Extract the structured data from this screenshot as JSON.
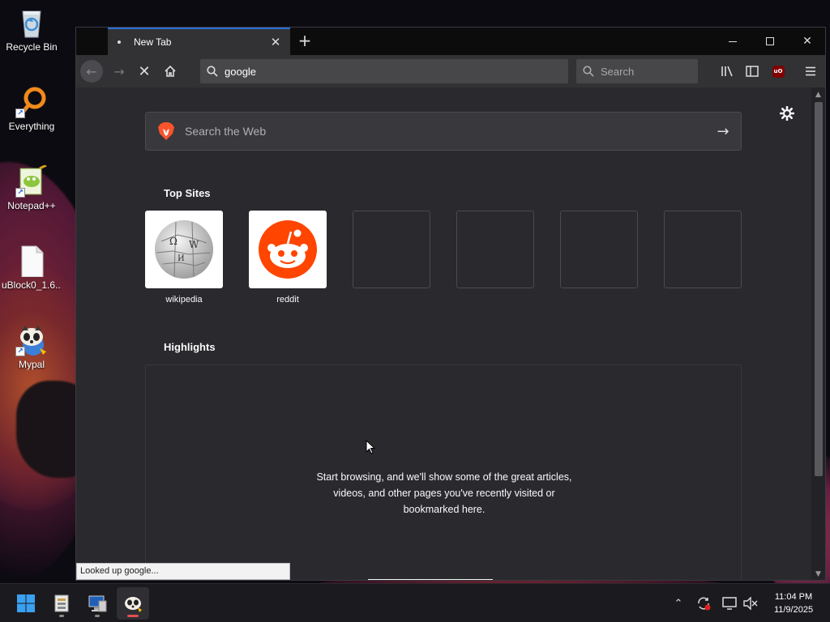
{
  "desktop": {
    "icons": [
      {
        "label": "Recycle Bin",
        "icon": "recycle-bin-icon"
      },
      {
        "label": "Everything",
        "icon": "everything-search-icon"
      },
      {
        "label": "Notepad++",
        "icon": "notepad-plus-plus-icon"
      },
      {
        "label": "uBlock0_1.6...",
        "icon": "file-icon"
      },
      {
        "label": "Mypal",
        "icon": "mypal-browser-icon"
      }
    ]
  },
  "browser": {
    "tab": {
      "title": "New Tab",
      "close_icon": "close-icon"
    },
    "new_tab_icon": "plus-icon",
    "window_controls": {
      "minimize": "minimize-icon",
      "maximize": "maximize-icon",
      "close": "close-icon"
    },
    "navbar": {
      "url_value": "google",
      "search_placeholder": "Search"
    },
    "page": {
      "search_web_placeholder": "Search the Web",
      "top_sites_title": "Top Sites",
      "top_sites": [
        {
          "label": "wikipedia",
          "icon": "wikipedia-globe-icon"
        },
        {
          "label": "reddit",
          "icon": "reddit-icon"
        },
        {
          "label": ""
        },
        {
          "label": ""
        },
        {
          "label": ""
        },
        {
          "label": ""
        }
      ],
      "highlights_title": "Highlights",
      "highlights_line1": "Start browsing, and we'll show some of the great articles,",
      "highlights_line2": "videos, and other pages you've recently visited or",
      "highlights_line3": "bookmarked here."
    },
    "status_text": "Looked up google..."
  },
  "taskbar": {
    "clock_time": "11:04 PM",
    "clock_date": "11/9/2025",
    "apps": [
      "start-icon",
      "file-manager-icon",
      "computer-icon",
      "mypal-browser-icon"
    ]
  },
  "colors": {
    "accent": "#2a6fd6",
    "reddit": "#ff4500",
    "ublock": "#800000"
  }
}
